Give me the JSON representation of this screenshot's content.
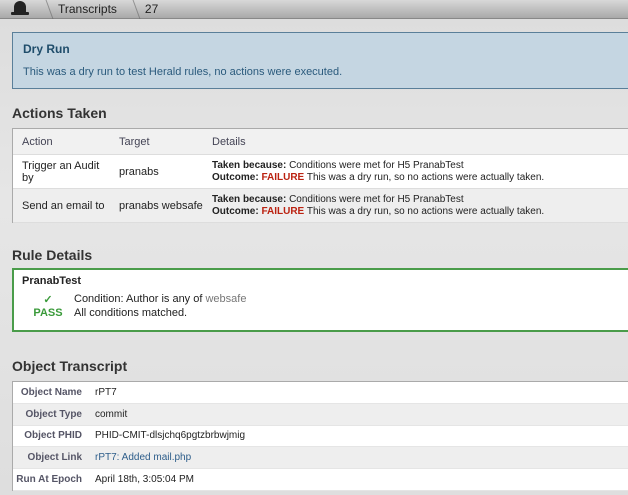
{
  "breadcrumb": {
    "items": [
      "Transcripts",
      "27"
    ]
  },
  "dry_run": {
    "title": "Dry Run",
    "message": "This was a dry run to test Herald rules, no actions were executed."
  },
  "actions": {
    "heading": "Actions Taken",
    "columns": [
      "Action",
      "Target",
      "Details"
    ],
    "rows": [
      {
        "action": "Trigger an Audit by",
        "target": "pranabs",
        "because_label": "Taken because:",
        "because": "Conditions were met for H5 PranabTest",
        "outcome_label": "Outcome:",
        "status": "FAILURE",
        "outcome": "This was a dry run, so no actions were actually taken."
      },
      {
        "action": "Send an email to",
        "target": "pranabs websafe",
        "because_label": "Taken because:",
        "because": "Conditions were met for H5 PranabTest",
        "outcome_label": "Outcome:",
        "status": "FAILURE",
        "outcome": "This was a dry run, so no actions were actually taken."
      }
    ]
  },
  "rule": {
    "heading": "Rule Details",
    "name": "PranabTest",
    "check": "✓",
    "condition": "Condition: Author is any of",
    "condition_value": "websafe",
    "pass": "PASS",
    "pass_text": "All conditions matched."
  },
  "object": {
    "heading": "Object Transcript",
    "rows": [
      {
        "label": "Object Name",
        "value": "rPT7"
      },
      {
        "label": "Object Type",
        "value": "commit"
      },
      {
        "label": "Object PHID",
        "value": "PHID-CMIT-dlsjchq6pgtzbrbwjmig"
      },
      {
        "label": "Object Link",
        "value": "rPT7: Added mail.php"
      },
      {
        "label": "Run At Epoch",
        "value": "April 18th, 3:05:04 PM"
      }
    ]
  },
  "colors": {
    "failure": "#bb2211",
    "pass": "#3a9a3a",
    "link": "#2d5d8a"
  }
}
